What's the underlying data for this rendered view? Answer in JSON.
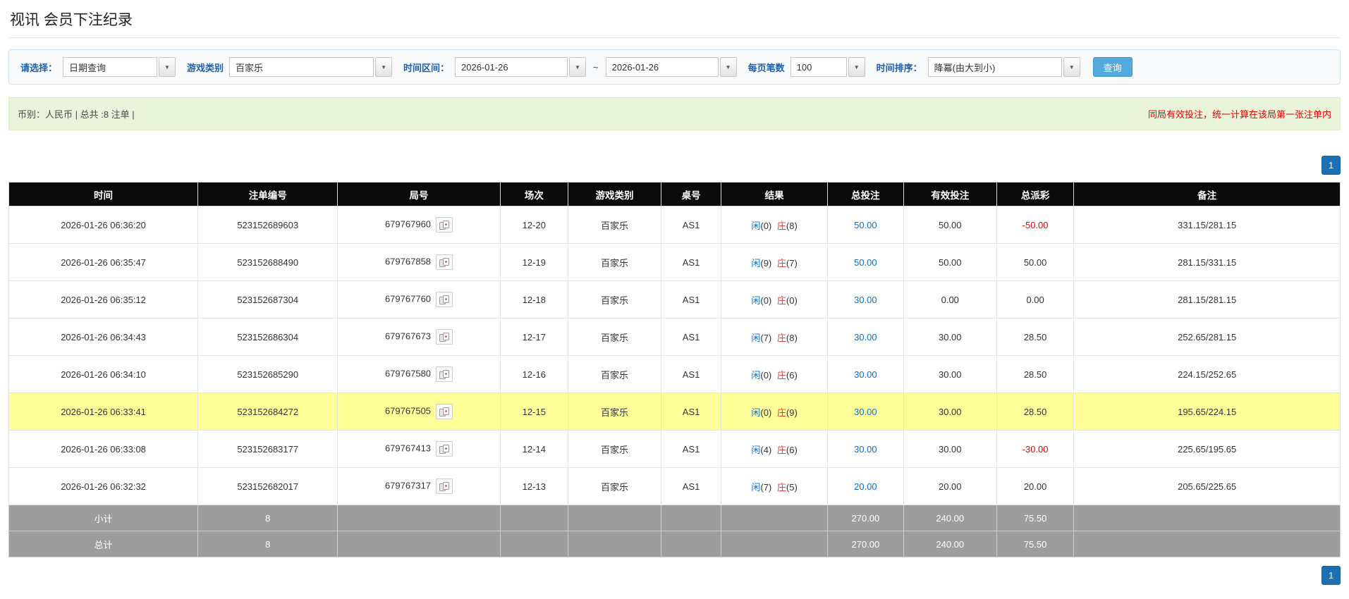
{
  "page": {
    "title": "视讯 会员下注纪录"
  },
  "colors": {
    "label-blue": "#1d5fae",
    "link-blue": "#0d6fc4",
    "banker-red": "#e03c3c",
    "negative-red": "#e60000",
    "notice-red": "#e60000",
    "highlight-yellow": "#ffff99",
    "header-black": "#0b0b0b",
    "footer-gray": "#9d9d9d",
    "btn-blue": "#54aadd",
    "page-btn-blue": "#1d6fb5",
    "summary-bg": "#e9f4da"
  },
  "filters": {
    "select_label": "请选择：",
    "select_value": "日期查询",
    "game_label": "游戏类别",
    "game_value": "百家乐",
    "range_label": "时间区间：",
    "date_from": "2026-01-26",
    "range_separator": "~",
    "date_to": "2026-01-26",
    "page_size_label": "每页笔数",
    "page_size_value": "100",
    "sort_label": "时间排序：",
    "sort_value": "降冪(由大到小)",
    "search_label": "查询",
    "arrow_glyph": "▼"
  },
  "summary": {
    "left": "币别：人民币 | 总共 :8 注单 |",
    "right": "同局有效投注，统一计算在该局第一张注单内"
  },
  "pagination": {
    "current": "1"
  },
  "table": {
    "headers": [
      "时间",
      "注单编号",
      "局号",
      "场次",
      "游戏类别",
      "桌号",
      "结果",
      "总投注",
      "有效投注",
      "总派彩",
      "备注"
    ],
    "rows": [
      {
        "time": "2026-01-26 06:36:20",
        "bet_id": "523152689603",
        "round": "679767960",
        "session": "12-20",
        "game": "百家乐",
        "table_no": "AS1",
        "result": {
          "p": "闲",
          "pn": "(0)",
          "b": "庄",
          "bn": "(8)"
        },
        "total_bet": "50.00",
        "valid_bet": "50.00",
        "payout": "-50.00",
        "remark": "331.15/281.15",
        "highlight": false
      },
      {
        "time": "2026-01-26 06:35:47",
        "bet_id": "523152688490",
        "round": "679767858",
        "session": "12-19",
        "game": "百家乐",
        "table_no": "AS1",
        "result": {
          "p": "闲",
          "pn": "(9)",
          "b": "庄",
          "bn": "(7)"
        },
        "total_bet": "50.00",
        "valid_bet": "50.00",
        "payout": "50.00",
        "remark": "281.15/331.15",
        "highlight": false
      },
      {
        "time": "2026-01-26 06:35:12",
        "bet_id": "523152687304",
        "round": "679767760",
        "session": "12-18",
        "game": "百家乐",
        "table_no": "AS1",
        "result": {
          "p": "闲",
          "pn": "(0)",
          "b": "庄",
          "bn": "(0)"
        },
        "total_bet": "30.00",
        "valid_bet": "0.00",
        "payout": "0.00",
        "remark": "281.15/281.15",
        "highlight": false
      },
      {
        "time": "2026-01-26 06:34:43",
        "bet_id": "523152686304",
        "round": "679767673",
        "session": "12-17",
        "game": "百家乐",
        "table_no": "AS1",
        "result": {
          "p": "闲",
          "pn": "(7)",
          "b": "庄",
          "bn": "(8)"
        },
        "total_bet": "30.00",
        "valid_bet": "30.00",
        "payout": "28.50",
        "remark": "252.65/281.15",
        "highlight": false
      },
      {
        "time": "2026-01-26 06:34:10",
        "bet_id": "523152685290",
        "round": "679767580",
        "session": "12-16",
        "game": "百家乐",
        "table_no": "AS1",
        "result": {
          "p": "闲",
          "pn": "(0)",
          "b": "庄",
          "bn": "(6)"
        },
        "total_bet": "30.00",
        "valid_bet": "30.00",
        "payout": "28.50",
        "remark": "224.15/252.65",
        "highlight": false
      },
      {
        "time": "2026-01-26 06:33:41",
        "bet_id": "523152684272",
        "round": "679767505",
        "session": "12-15",
        "game": "百家乐",
        "table_no": "AS1",
        "result": {
          "p": "闲",
          "pn": "(0)",
          "b": "庄",
          "bn": "(9)"
        },
        "total_bet": "30.00",
        "valid_bet": "30.00",
        "payout": "28.50",
        "remark": "195.65/224.15",
        "highlight": true
      },
      {
        "time": "2026-01-26 06:33:08",
        "bet_id": "523152683177",
        "round": "679767413",
        "session": "12-14",
        "game": "百家乐",
        "table_no": "AS1",
        "result": {
          "p": "闲",
          "pn": "(4)",
          "b": "庄",
          "bn": "(6)"
        },
        "total_bet": "30.00",
        "valid_bet": "30.00",
        "payout": "-30.00",
        "remark": "225.65/195.65",
        "highlight": false
      },
      {
        "time": "2026-01-26 06:32:32",
        "bet_id": "523152682017",
        "round": "679767317",
        "session": "12-13",
        "game": "百家乐",
        "table_no": "AS1",
        "result": {
          "p": "闲",
          "pn": "(7)",
          "b": "庄",
          "bn": "(5)"
        },
        "total_bet": "20.00",
        "valid_bet": "20.00",
        "payout": "20.00",
        "remark": "205.65/225.65",
        "highlight": false
      }
    ],
    "subtotal": {
      "label": "小计",
      "count": "8",
      "total_bet": "270.00",
      "valid_bet": "240.00",
      "payout": "75.50"
    },
    "total": {
      "label": "总计",
      "count": "8",
      "total_bet": "270.00",
      "valid_bet": "240.00",
      "payout": "75.50"
    }
  }
}
